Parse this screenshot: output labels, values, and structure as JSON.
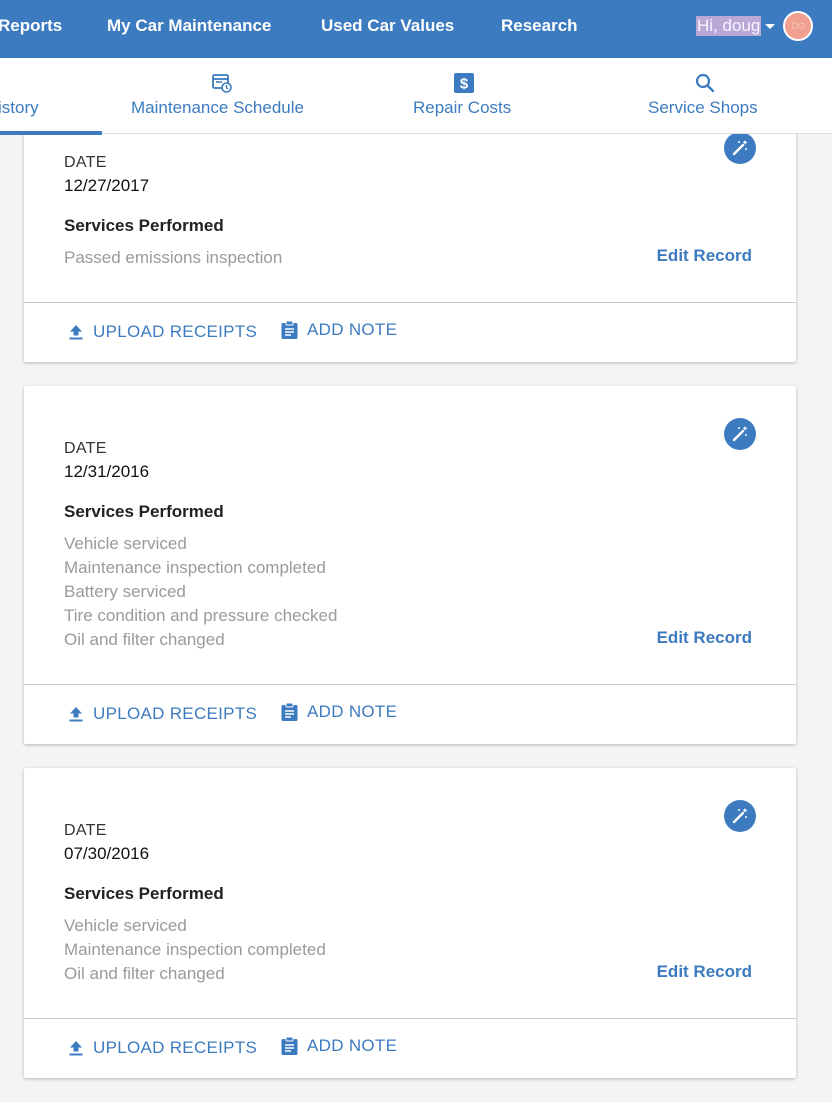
{
  "topnav": {
    "links": [
      "Reports",
      "My Car Maintenance",
      "Used Car Values",
      "Research"
    ],
    "greeting": "Hi, doug",
    "avatar_initials": "DO"
  },
  "tabs": [
    {
      "label": "istory",
      "icon": "history-icon"
    },
    {
      "label": "Maintenance Schedule",
      "icon": "calendar-clock-icon"
    },
    {
      "label": "Repair Costs",
      "icon": "dollar-icon"
    },
    {
      "label": "Service Shops",
      "icon": "search-icon"
    }
  ],
  "records": [
    {
      "date_label": "DATE",
      "date": "12/27/2017",
      "services_title": "Services Performed",
      "services": [
        "Passed emissions inspection"
      ],
      "edit_label": "Edit Record",
      "upload_label": "UPLOAD RECEIPTS",
      "note_label": "ADD NOTE"
    },
    {
      "date_label": "DATE",
      "date": "12/31/2016",
      "services_title": "Services Performed",
      "services": [
        "Vehicle serviced",
        "Maintenance inspection completed",
        "Battery serviced",
        "Tire condition and pressure checked",
        "Oil and filter changed"
      ],
      "edit_label": "Edit Record",
      "upload_label": "UPLOAD RECEIPTS",
      "note_label": "ADD NOTE"
    },
    {
      "date_label": "DATE",
      "date": "07/30/2016",
      "services_title": "Services Performed",
      "services": [
        "Vehicle serviced",
        "Maintenance inspection completed",
        "Oil and filter changed"
      ],
      "edit_label": "Edit Record",
      "upload_label": "UPLOAD RECEIPTS",
      "note_label": "ADD NOTE"
    }
  ],
  "colors": {
    "brand": "#3d7bc0",
    "muted_text": "#9a9a9a",
    "background": "#f4f4f4"
  }
}
